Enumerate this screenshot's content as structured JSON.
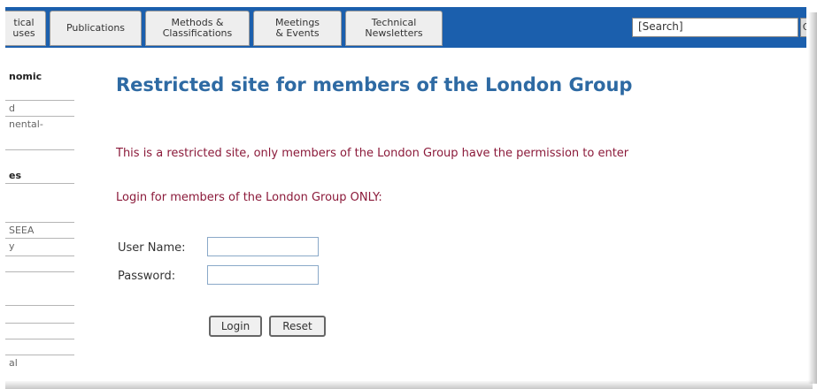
{
  "navbar": {
    "tabs": [
      {
        "label": "tical\nuses"
      },
      {
        "label": "Publications"
      },
      {
        "label": "Methods &\nClassifications"
      },
      {
        "label": "Meetings\n& Events"
      },
      {
        "label": "Technical\nNewsletters"
      }
    ],
    "search_placeholder": "[Search]",
    "search_button": "G"
  },
  "sidebar": {
    "items": [
      {
        "label": "nomic"
      },
      {
        "label": "d"
      },
      {
        "label": "nental-"
      },
      {
        "label": ""
      },
      {
        "label": "es"
      },
      {
        "label": ""
      },
      {
        "label": "SEEA"
      },
      {
        "label": "y"
      },
      {
        "label": ""
      },
      {
        "label": ""
      },
      {
        "label": ""
      },
      {
        "label": ""
      },
      {
        "label": ""
      },
      {
        "label": "al"
      }
    ]
  },
  "main": {
    "title": "Restricted site for members of the London Group",
    "restricted_message": "This is a restricted site, only members of the London Group have the permission to enter",
    "login_prompt": "Login for members of the London Group ONLY:",
    "username_label": "User Name:",
    "password_label": "Password:",
    "username_value": "",
    "password_value": "",
    "login_button": "Login",
    "reset_button": "Reset"
  }
}
